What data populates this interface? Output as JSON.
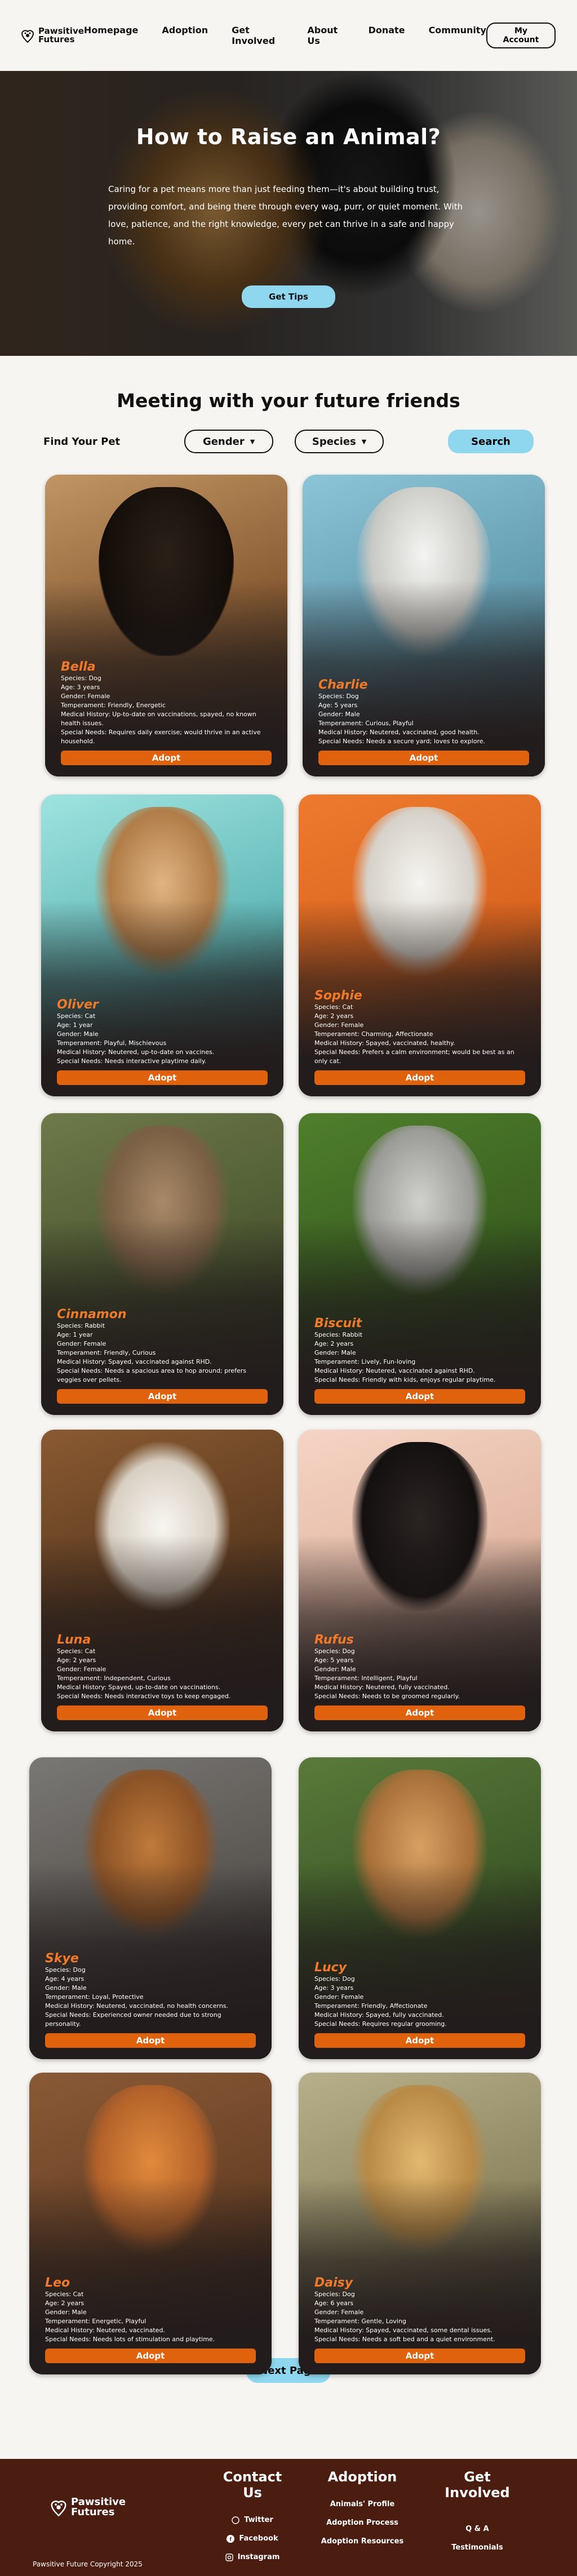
{
  "brand": {
    "name_line1": "Pawsitive",
    "name_line2": "Futures"
  },
  "nav": {
    "links": [
      "Homepage",
      "Adoption",
      "Get Involved",
      "About Us",
      "Donate",
      "Community"
    ],
    "account_label": "My Account"
  },
  "hero": {
    "title": "How to Raise an Animal?",
    "description": "Caring for a pet means more than just feeding them—it's about building trust, providing comfort, and being there through every wag, purr, or quiet moment. With love, patience, and the right knowledge, every pet can thrive in a safe and happy home.",
    "button_label": "Get Tips"
  },
  "meet": {
    "title": "Meeting with your future friends",
    "find_label": "Find Your Pet",
    "filters": [
      "Gender",
      "Species"
    ],
    "search_label": "Search"
  },
  "pets": [
    {
      "name": "Bella",
      "lines": [
        "Species: Dog",
        "Age: 3 years",
        "Gender: Female",
        "Temperament: Friendly, Energetic",
        "Medical History: Up-to-date on vaccinations, spayed, no known health issues.",
        "Special Needs: Requires daily exercise; would thrive in an active household."
      ]
    },
    {
      "name": "Charlie",
      "lines": [
        "Species: Dog",
        "Age: 5 years",
        "Gender: Male",
        "Temperament: Curious, Playful",
        "Medical History: Neutered, vaccinated, good health.",
        "Special Needs: Needs a secure yard; loves to explore."
      ]
    },
    {
      "name": "Oliver",
      "lines": [
        "Species: Cat",
        "Age: 1 year",
        "Gender: Male",
        "Temperament: Playful, Mischievous",
        "Medical History: Neutered, up-to-date on vaccines.",
        "Special Needs: Needs interactive playtime daily."
      ]
    },
    {
      "name": "Sophie",
      "lines": [
        "Species: Cat",
        "Age: 2 years",
        "Gender: Female",
        "Temperament: Charming, Affectionate",
        "Medical History: Spayed, vaccinated, healthy.",
        "Special Needs: Prefers a calm environment; would be best as an only cat."
      ]
    },
    {
      "name": "Cinnamon",
      "lines": [
        "Species: Rabbit",
        "Age: 1 year",
        "Gender: Female",
        "Temperament: Friendly, Curious",
        "Medical History: Spayed, vaccinated against RHD.",
        "Special Needs: Needs a spacious area to hop around; prefers veggies over pellets."
      ]
    },
    {
      "name": "Biscuit",
      "lines": [
        "Species: Rabbit",
        "Age: 2 years",
        "Gender: Male",
        "Temperament: Lively, Fun-loving",
        "Medical History: Neutered, vaccinated against RHD.",
        "Special Needs: Friendly with kids, enjoys regular playtime."
      ]
    },
    {
      "name": "Luna",
      "lines": [
        "Species: Cat",
        "Age: 2 years",
        "Gender: Female",
        "Temperament: Independent, Curious",
        "Medical History: Spayed, up-to-date on vaccinations.",
        "Special Needs: Needs interactive toys to keep engaged."
      ]
    },
    {
      "name": "Rufus",
      "lines": [
        "Species: Dog",
        "Age: 5 years",
        "Gender: Male",
        "Temperament: Intelligent, Playful",
        "Medical History: Neutered, fully vaccinated.",
        "Special Needs: Needs to be groomed regularly."
      ]
    },
    {
      "name": "Skye",
      "lines": [
        "Species: Dog",
        "Age: 4 years",
        "Gender: Male",
        "Temperament: Loyal, Protective",
        "Medical History: Neutered, vaccinated, no health concerns.",
        "Special Needs: Experienced owner needed due to strong personality."
      ]
    },
    {
      "name": "Lucy",
      "lines": [
        "Species: Dog",
        "Age: 3 years",
        "Gender: Female",
        "Temperament: Friendly, Affectionate",
        "Medical History: Spayed, fully vaccinated.",
        "Special Needs: Requires regular grooming."
      ]
    },
    {
      "name": "Leo",
      "lines": [
        "Species: Cat",
        "Age: 2 years",
        "Gender: Male",
        "Temperament: Energetic, Playful",
        "Medical History: Neutered, vaccinated.",
        "Special Needs: Needs lots of stimulation and playtime."
      ]
    },
    {
      "name": "Daisy",
      "lines": [
        "Species: Dog",
        "Age: 6 years",
        "Gender: Female",
        "Temperament: Gentle, Loving",
        "Medical History: Spayed, vaccinated, some dental issues.",
        "Special Needs: Needs a soft bed and a quiet environment."
      ]
    }
  ],
  "adopt_label": "Adopt",
  "next_label": "Next Page",
  "footer": {
    "contact_title": "Contact Us",
    "contact_items": [
      "Twitter",
      "Facebook",
      "Instagram"
    ],
    "adoption_title": "Adoption",
    "adoption_items": [
      "Animals' Profile",
      "Adoption Process",
      "Adoption Resources"
    ],
    "involved_title": "Get Involved",
    "involved_items": [
      "Q & A",
      "Testimonials"
    ],
    "copyright": "Pawsitive Future Copyright 2025"
  },
  "colors": {
    "accent_orange": "#e0620d",
    "name_orange": "#f07a2a",
    "button_blue": "#8fd7ef",
    "footer_brown": "#4b1c10"
  }
}
